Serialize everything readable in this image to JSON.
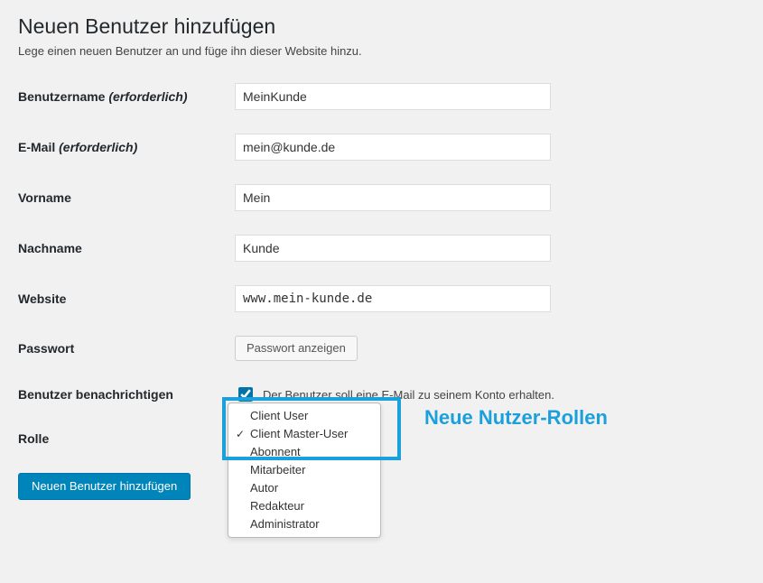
{
  "heading": "Neuen Benutzer hinzufügen",
  "subtitle": "Lege einen neuen Benutzer an und füge ihn dieser Website hinzu.",
  "required_suffix": "(erforderlich)",
  "fields": {
    "username": {
      "label": "Benutzername",
      "required": true,
      "value": "MeinKunde"
    },
    "email": {
      "label": "E-Mail",
      "required": true,
      "value": "mein@kunde.de"
    },
    "firstname": {
      "label": "Vorname",
      "value": "Mein"
    },
    "lastname": {
      "label": "Nachname",
      "value": "Kunde"
    },
    "website": {
      "label": "Website",
      "value": "www.mein-kunde.de"
    },
    "password": {
      "label": "Passwort",
      "button": "Passwort anzeigen"
    },
    "notify": {
      "label": "Benutzer benachrichtigen",
      "checked": true,
      "text": "Der Benutzer soll eine E-Mail zu seinem Konto erhalten."
    },
    "role": {
      "label": "Rolle"
    }
  },
  "role_options": [
    {
      "label": "Client User",
      "selected": false
    },
    {
      "label": "Client Master-User",
      "selected": true
    },
    {
      "label": "Abonnent",
      "selected": false
    },
    {
      "label": "Mitarbeiter",
      "selected": false
    },
    {
      "label": "Autor",
      "selected": false
    },
    {
      "label": "Redakteur",
      "selected": false
    },
    {
      "label": "Administrator",
      "selected": false
    }
  ],
  "annotation": "Neue Nutzer-Rollen",
  "submit": "Neuen Benutzer hinzufügen"
}
